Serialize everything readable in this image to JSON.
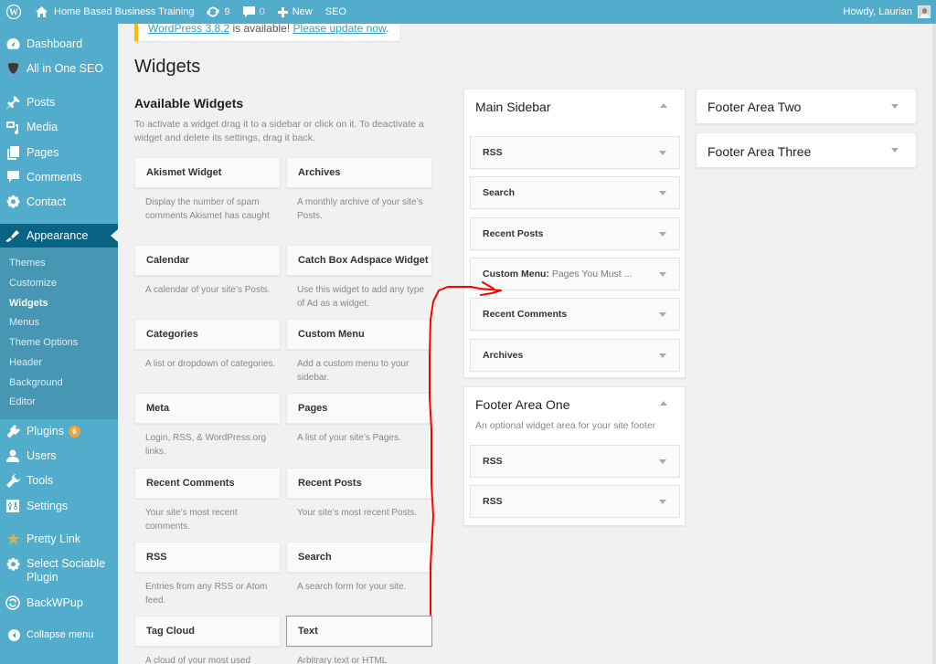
{
  "adminbar": {
    "site_name": "Home Based Business Training",
    "updates_count": "9",
    "comments_count": "0",
    "new_label": "New",
    "seo_label": "SEO",
    "howdy": "Howdy, Laurian"
  },
  "menu": {
    "dashboard": "Dashboard",
    "all_in_one_seo": "All in One SEO",
    "posts": "Posts",
    "media": "Media",
    "pages": "Pages",
    "comments": "Comments",
    "contact": "Contact",
    "appearance": "Appearance",
    "submenu": [
      "Themes",
      "Customize",
      "Widgets",
      "Menus",
      "Theme Options",
      "Header",
      "Background",
      "Editor"
    ],
    "plugins": "Plugins",
    "plugins_badge": "6",
    "users": "Users",
    "tools": "Tools",
    "settings": "Settings",
    "pretty_link": "Pretty Link",
    "select_sociable_1": "Select Sociable",
    "select_sociable_2": "Plugin",
    "backwpup": "BackWPup",
    "collapse": "Collapse menu"
  },
  "notice": {
    "version_link": "WordPress 3.8.2",
    "middle": " is available! ",
    "update_link": "Please update now",
    "end": "."
  },
  "page": {
    "title": "Widgets",
    "available_title": "Available Widgets",
    "available_desc": "To activate a widget drag it to a sidebar or click on it. To deactivate a widget and delete its settings, drag it back."
  },
  "available_widgets": [
    {
      "title": "Akismet Widget",
      "desc": "Display the number of spam comments Akismet has caught"
    },
    {
      "title": "Archives",
      "desc": "A monthly archive of your site’s Posts."
    },
    {
      "title": "Calendar",
      "desc": "A calendar of your site’s Posts."
    },
    {
      "title": "Catch Box Adspace Widget",
      "desc": "Use this widget to add any type of Ad as a widget."
    },
    {
      "title": "Categories",
      "desc": "A list or dropdown of categories."
    },
    {
      "title": "Custom Menu",
      "desc": "Add a custom menu to your sidebar."
    },
    {
      "title": "Meta",
      "desc": "Login, RSS, & WordPress.org links."
    },
    {
      "title": "Pages",
      "desc": "A list of your site’s Pages."
    },
    {
      "title": "Recent Comments",
      "desc": "Your site’s most recent comments."
    },
    {
      "title": "Recent Posts",
      "desc": "Your site’s most recent Posts."
    },
    {
      "title": "RSS",
      "desc": "Entries from any RSS or Atom feed."
    },
    {
      "title": "Search",
      "desc": "A search form for your site."
    },
    {
      "title": "Tag Cloud",
      "desc": "A cloud of your most used"
    },
    {
      "title": "Text",
      "desc": "Arbitrary text or HTML"
    }
  ],
  "main_sidebar": {
    "title": "Main Sidebar",
    "widgets": [
      {
        "title": "RSS",
        "sub": ""
      },
      {
        "title": "Search",
        "sub": ""
      },
      {
        "title": "Recent Posts",
        "sub": ""
      },
      {
        "title": "Custom Menu:",
        "sub": " Pages You Must ..."
      },
      {
        "title": "Recent Comments",
        "sub": ""
      },
      {
        "title": "Archives",
        "sub": ""
      }
    ]
  },
  "footer_one": {
    "title": "Footer Area One",
    "desc": "An optional widget area for your site footer",
    "widgets": [
      {
        "title": "RSS"
      },
      {
        "title": "RSS"
      }
    ]
  },
  "footer_two": {
    "title": "Footer Area Two"
  },
  "footer_three": {
    "title": "Footer Area Three"
  },
  "colors": {
    "adminbar": "#52accc",
    "menu_current": "#096484",
    "submenu": "#4796b3",
    "badge": "#f0a23a",
    "annotation": "#ff0000"
  }
}
